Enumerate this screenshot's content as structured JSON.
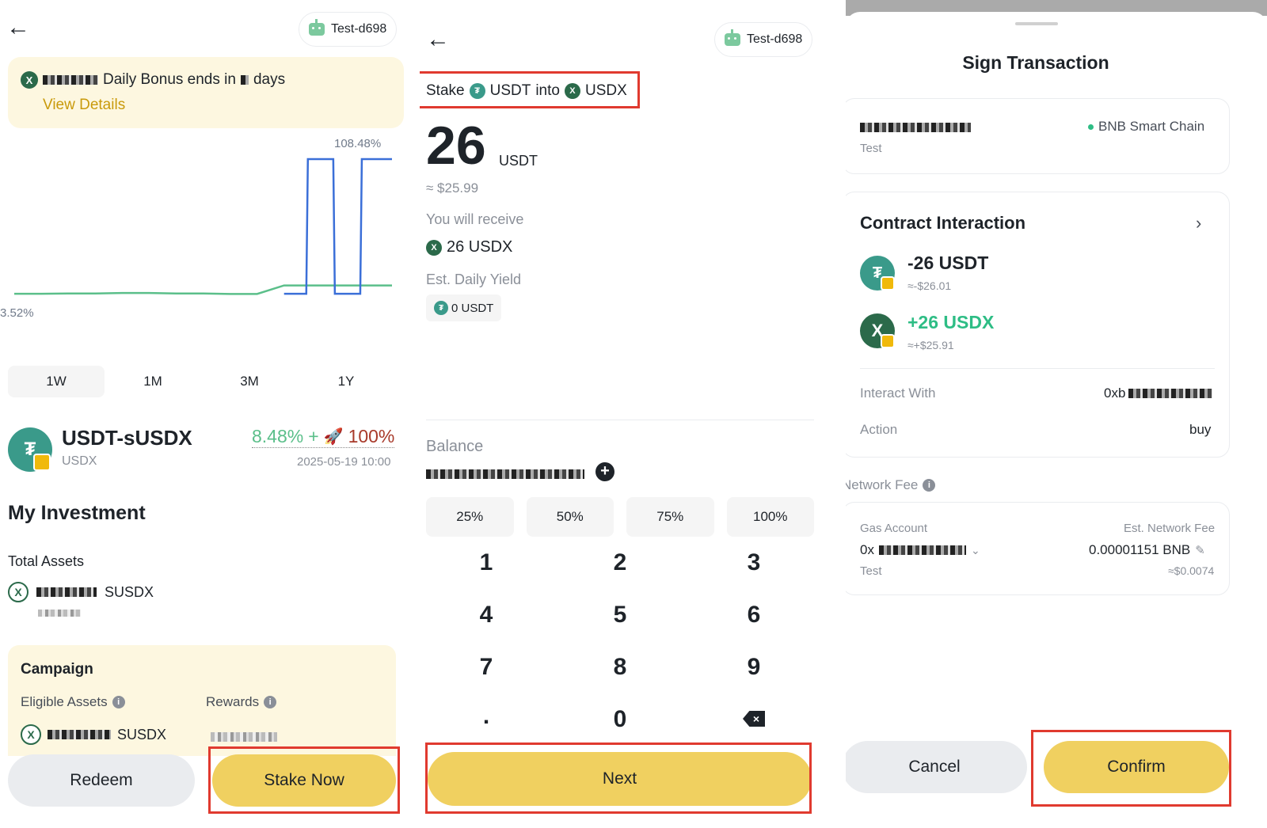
{
  "wallet": {
    "name": "Test-d698"
  },
  "panel1": {
    "banner": {
      "text": "Daily Bonus ends in",
      "suffix": "days",
      "link": "View Details"
    },
    "chart_data": {
      "type": "line",
      "title": "",
      "series": [
        {
          "values": [
            3.52,
            3.52,
            3.55,
            3.55,
            3.6,
            3.6,
            3.55,
            3.55,
            3.5,
            3.5,
            4.5,
            4.5,
            4.5,
            4.5,
            4.5
          ]
        },
        {
          "values": [
            null,
            null,
            null,
            null,
            null,
            null,
            null,
            null,
            null,
            null,
            3.52,
            108.48,
            3.52,
            108.48,
            108.48
          ]
        }
      ],
      "max_label": "108.48%",
      "min_label": "3.52%",
      "colors": [
        "#5bbf8a",
        "#3b6fd8"
      ]
    },
    "ranges": [
      "1W",
      "1M",
      "3M",
      "1Y"
    ],
    "active_range": "1M",
    "product": {
      "name": "USDT-sUSDX",
      "sub": "USDX",
      "apr": "8.48%",
      "plus": "+",
      "boost": "100%",
      "date": "2025-05-19 10:00"
    },
    "investment": {
      "title": "My Investment",
      "total_label": "Total Assets",
      "token": "SUSDX"
    },
    "campaign": {
      "title": "Campaign",
      "eligible_label": "Eligible Assets",
      "rewards_label": "Rewards",
      "token": "SUSDX"
    },
    "buttons": {
      "redeem": "Redeem",
      "stake": "Stake Now"
    }
  },
  "panel2": {
    "stake_prefix": "Stake",
    "from_token": "USDT",
    "into": "into",
    "to_token": "USDX",
    "amount": "26",
    "amount_unit": "USDT",
    "fiat": "≈ $25.99",
    "receive_label": "You will receive",
    "receive_value": "26 USDX",
    "yield_label": "Est. Daily Yield",
    "yield_value": "0 USDT",
    "balance_label": "Balance",
    "percents": [
      "25%",
      "50%",
      "75%",
      "100%"
    ],
    "keys": [
      "1",
      "2",
      "3",
      "4",
      "5",
      "6",
      "7",
      "8",
      "9",
      ".",
      "0"
    ],
    "next": "Next"
  },
  "panel3": {
    "title": "Sign Transaction",
    "account_label": "Test",
    "chain": "BNB Smart Chain",
    "contract_title": "Contract Interaction",
    "out": {
      "amount": "-26 USDT",
      "fiat": "≈-$26.01"
    },
    "in": {
      "amount": "+26 USDX",
      "fiat": "≈+$25.91"
    },
    "interact_label": "Interact With",
    "interact_value": "0xb",
    "action_label": "Action",
    "action_value": "buy",
    "fee_label": "Network Fee",
    "gas_label": "Gas Account",
    "gas_prefix": "0x",
    "gas_sub": "Test",
    "est_fee_label": "Est. Network Fee",
    "est_fee_value": "0.00001151 BNB",
    "est_fee_fiat": "≈$0.0074",
    "cancel": "Cancel",
    "confirm": "Confirm"
  }
}
